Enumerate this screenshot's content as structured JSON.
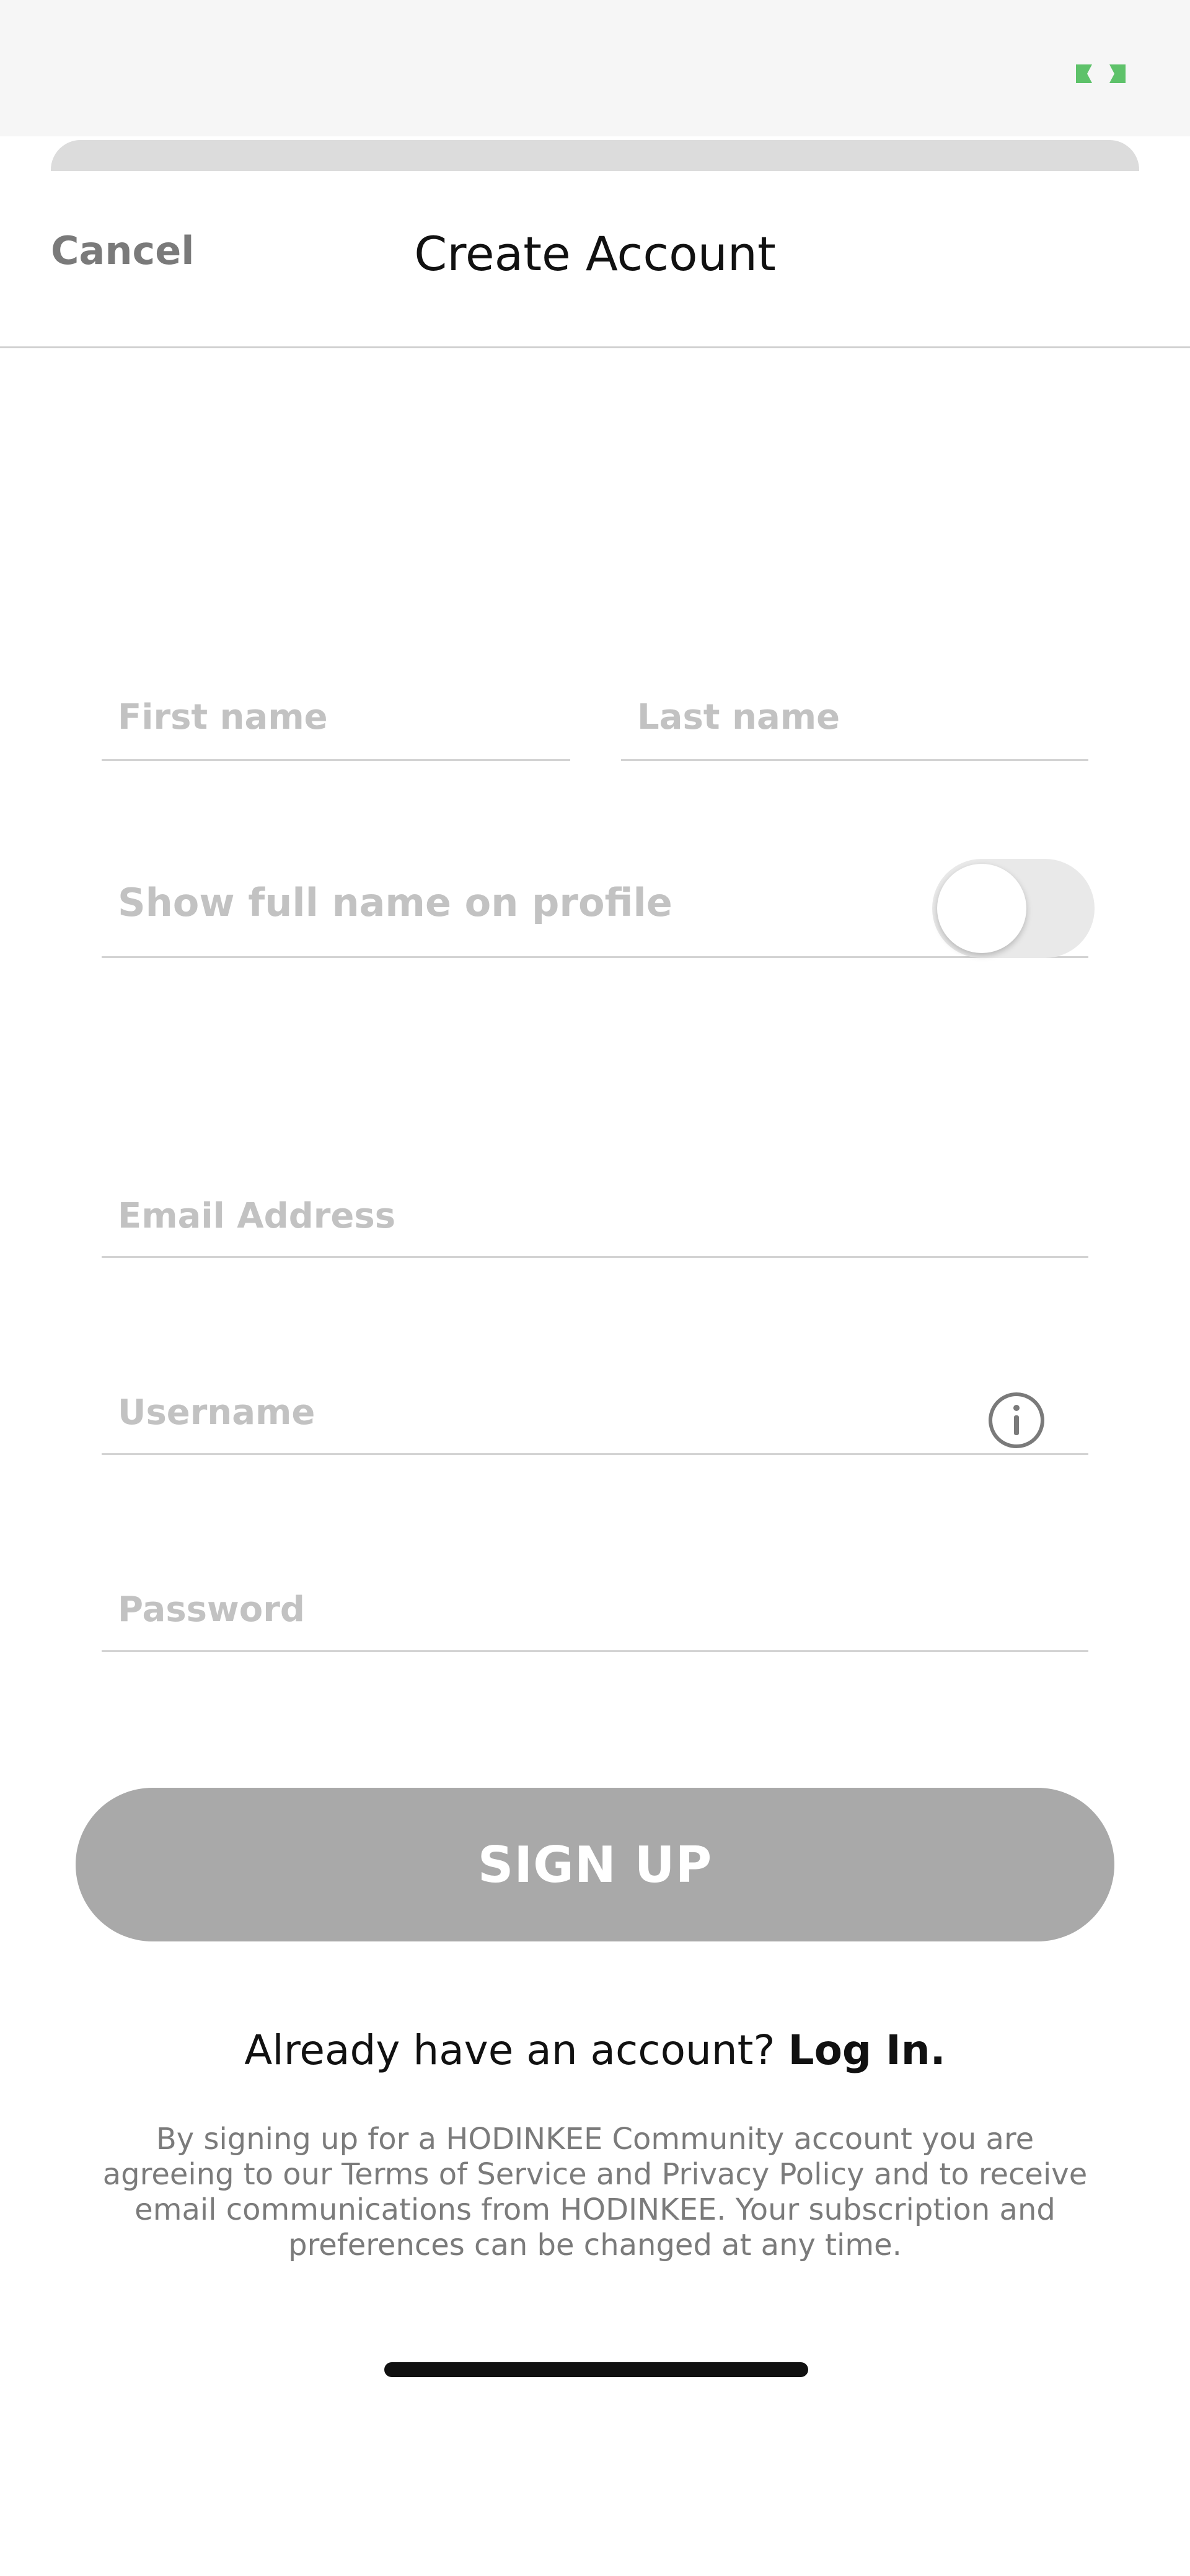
{
  "header": {
    "cancel_label": "Cancel",
    "title": "Create Account"
  },
  "form": {
    "first_name": {
      "placeholder": "First name",
      "value": ""
    },
    "last_name": {
      "placeholder": "Last name",
      "value": ""
    },
    "show_full_name": {
      "label": "Show full name on profile",
      "enabled": false
    },
    "email": {
      "placeholder": "Email Address",
      "value": ""
    },
    "username": {
      "placeholder": "Username",
      "value": "",
      "info_icon": "info-icon"
    },
    "password": {
      "placeholder": "Password",
      "value": ""
    }
  },
  "actions": {
    "signup_label": "SIGN UP",
    "login_prompt": "Already have an account?",
    "login_link": "Log In."
  },
  "legal_text": "By signing up for a HODINKEE Community account you are agreeing to our Terms of Service and Privacy Policy and to receive email communications from HODINKEE. Your subscription and preferences can be changed at any time.",
  "colors": {
    "signup_disabled": "#a9a9a9",
    "status_accent": "#5ec26a",
    "toggle_off": "#e9e9e9"
  }
}
